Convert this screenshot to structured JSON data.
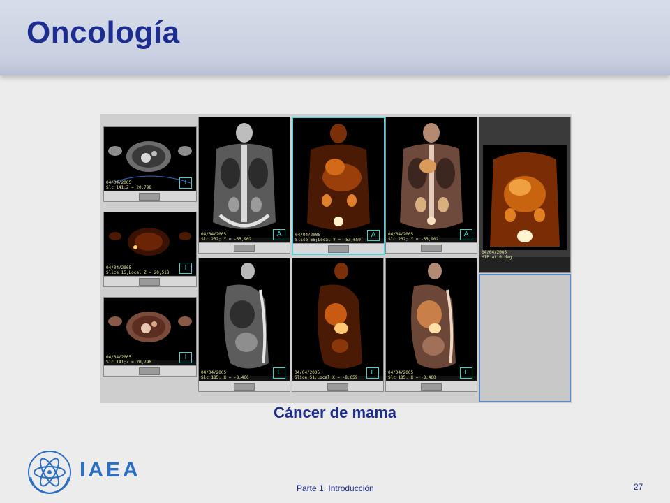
{
  "slide": {
    "title": "Oncología",
    "caption": "Cáncer de mama",
    "footer": "Parte 1. Introducción",
    "page_number": "27",
    "logo_text": "IAEA",
    "colors": {
      "title": "#1d2c8f",
      "logo": "#2a6fc4",
      "header_band": "#c8cfe0"
    }
  },
  "viewer": {
    "axial_panes": [
      {
        "caption": "04/04/2005\nSlc 141;Z = 20,798",
        "tag": "I",
        "type": "ct"
      },
      {
        "caption": "04/04/2005\nSlice 15;Local Z = 20,518",
        "tag": "I",
        "type": "pet"
      },
      {
        "caption": "04/04/2005\nSlc 141;Z = 20,798",
        "tag": "I",
        "type": "fused"
      }
    ],
    "coronal_panes": [
      {
        "caption": "04/04/2005\nSlc 232; Y = -55,902",
        "tag": "A",
        "type": "ct"
      },
      {
        "caption": "04/04/2005\nSlice 65;Local Y = -53,659",
        "tag": "A",
        "type": "pet"
      },
      {
        "caption": "04/04/2005\nSlc 232; Y = -55,902",
        "tag": "A",
        "type": "fused"
      }
    ],
    "sagittal_panes": [
      {
        "caption": "04/04/2005\nSlc 185; X = -8,460",
        "tag": "L",
        "type": "ct"
      },
      {
        "caption": "04/04/2005\nSlice 51;Local X = -8,659",
        "tag": "L",
        "type": "pet"
      },
      {
        "caption": "04/04/2005\nSlc 185; X = -8,460",
        "tag": "L",
        "type": "fused"
      }
    ],
    "mip_pane": {
      "caption": "04/04/2005\nMIP at 0 deg"
    }
  }
}
